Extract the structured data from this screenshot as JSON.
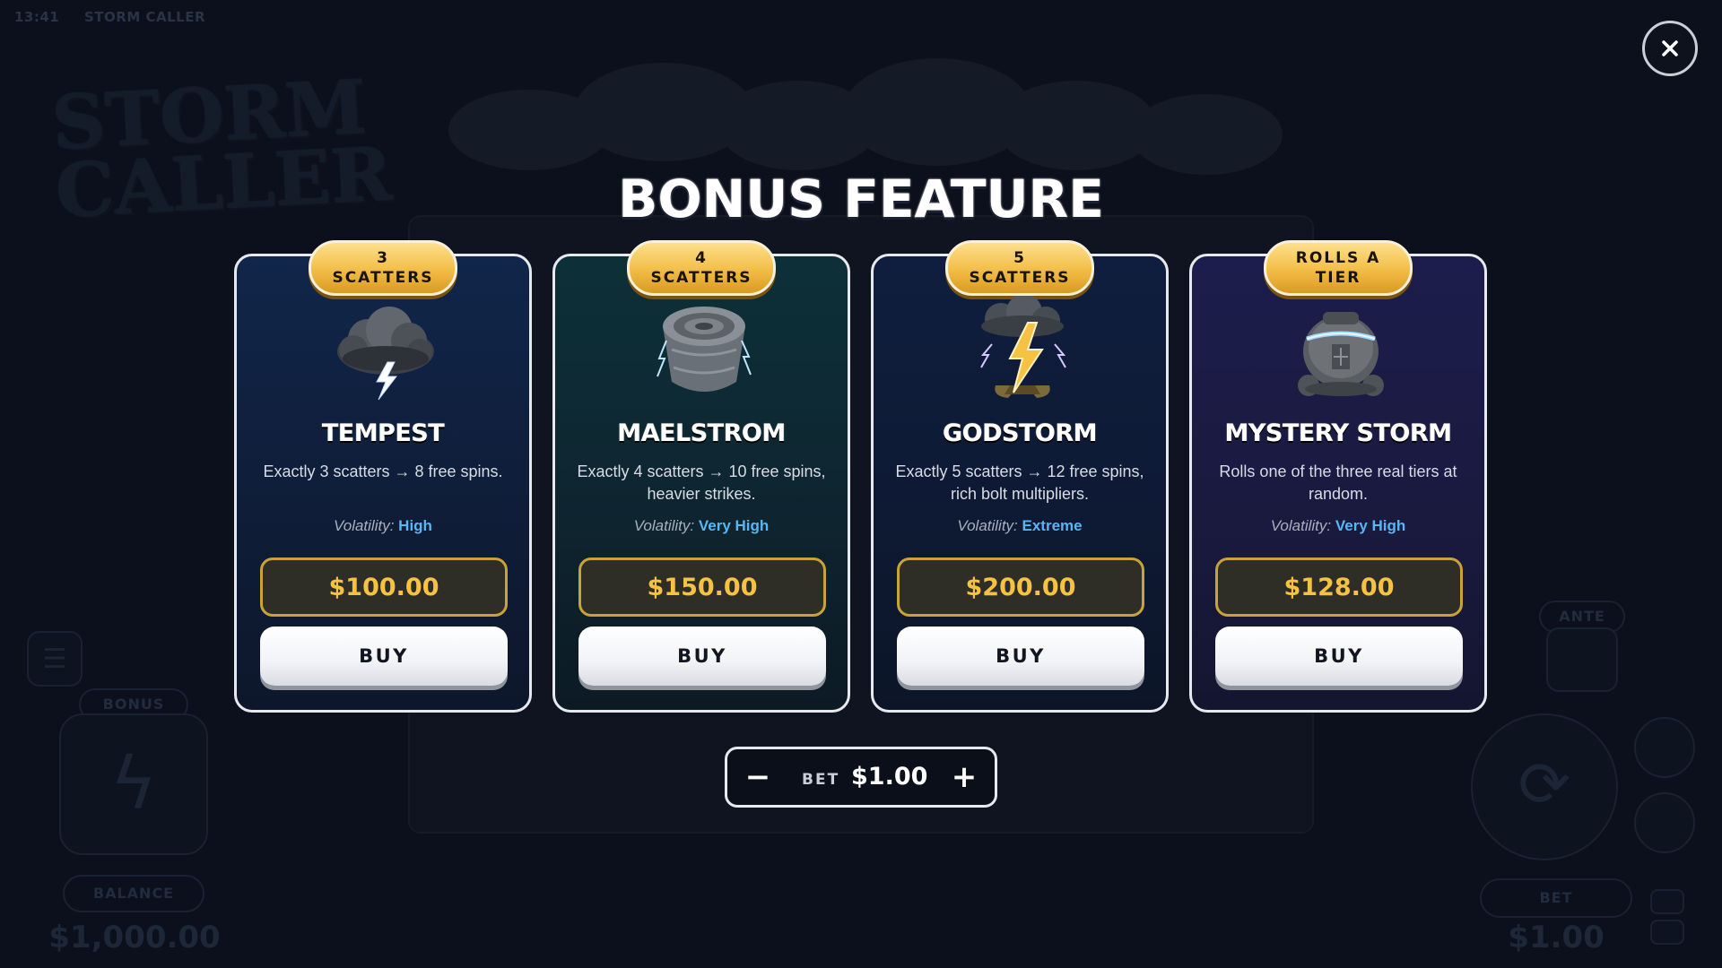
{
  "background": {
    "status_time": "13:41",
    "status_title": "STORM CALLER",
    "logo_line1": "STORM",
    "logo_line2": "CALLER",
    "bonus_label": "BONUS",
    "balance_label": "BALANCE",
    "balance_value": "$1,000.00",
    "ante_label": "ANTE",
    "bet_label": "BET",
    "bet_value": "$1.00"
  },
  "modal": {
    "title": "BONUS FEATURE",
    "close_icon": "close-icon",
    "cards": [
      {
        "badge": "3\nSCATTERS",
        "icon": "storm-cloud-icon",
        "name": "TEMPEST",
        "description": "Exactly 3 scatters → 8 free spins.",
        "volatility_label": "Volatility:",
        "volatility": "High",
        "price": "$100.00",
        "buy_label": "BUY"
      },
      {
        "badge": "4\nSCATTERS",
        "icon": "whirlpool-icon",
        "name": "MAELSTROM",
        "description": "Exactly 4 scatters → 10 free spins, heavier strikes.",
        "volatility_label": "Volatility:",
        "volatility": "Very High",
        "price": "$150.00",
        "buy_label": "BUY"
      },
      {
        "badge": "5\nSCATTERS",
        "icon": "lightning-bolt-icon",
        "name": "GODSTORM",
        "description": "Exactly 5 scatters → 12 free spins, rich bolt multipliers.",
        "volatility_label": "Volatility:",
        "volatility": "Extreme",
        "price": "$200.00",
        "buy_label": "BUY"
      },
      {
        "badge": "ROLLS A\nTIER",
        "icon": "mystery-urn-icon",
        "name": "MYSTERY STORM",
        "description": "Rolls one of the three real tiers at random.",
        "volatility_label": "Volatility:",
        "volatility": "Very High",
        "price": "$128.00",
        "buy_label": "BUY"
      }
    ],
    "bet": {
      "minus": "−",
      "label": "BET",
      "value": "$1.00",
      "plus": "+"
    }
  },
  "colors": {
    "accent_gold": "#f6c244",
    "volatility_blue": "#58b6f3",
    "background": "#0b101c"
  }
}
